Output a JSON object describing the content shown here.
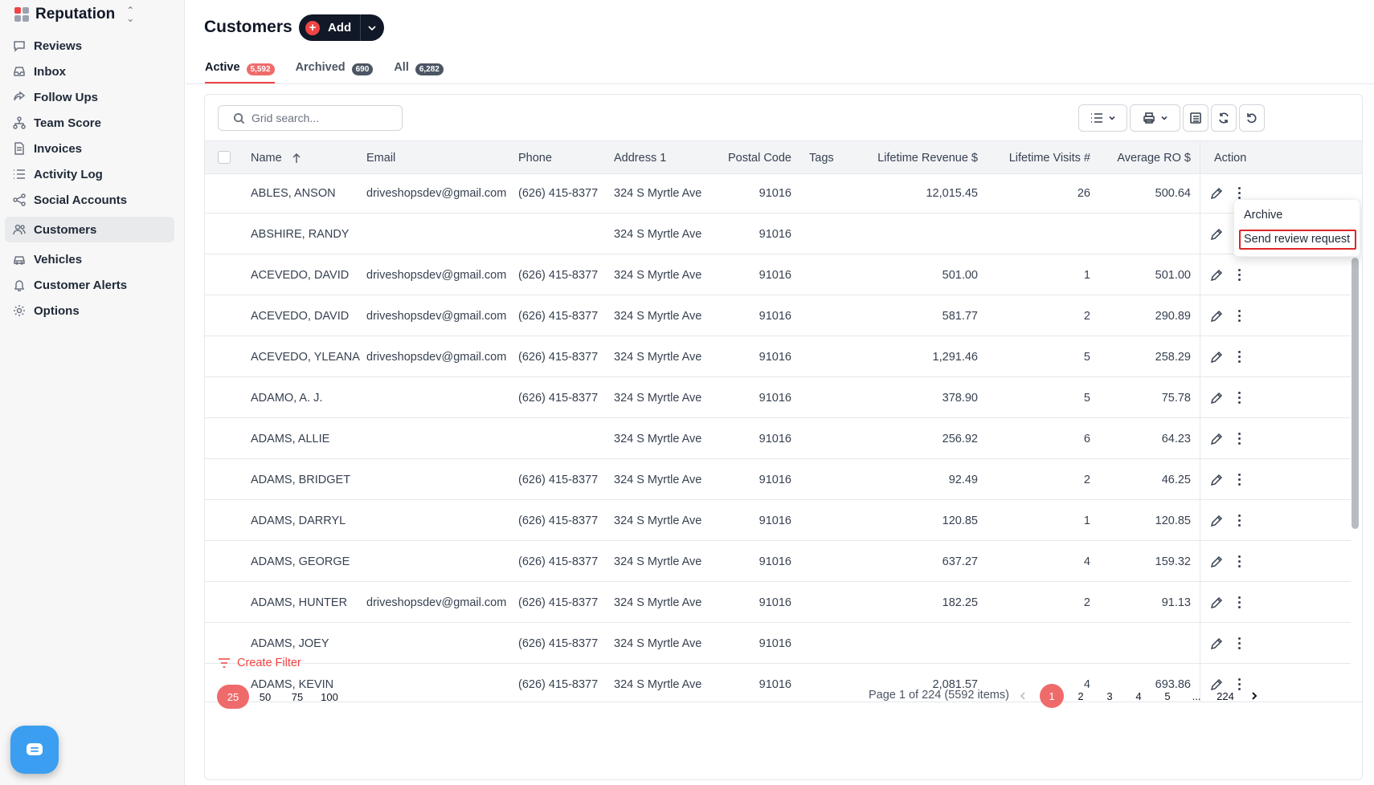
{
  "brand": {
    "name": "Reputation"
  },
  "sidebar": {
    "items": [
      {
        "label": "Reviews",
        "icon": "message-square-icon"
      },
      {
        "label": "Inbox",
        "icon": "inbox-icon"
      },
      {
        "label": "Follow Ups",
        "icon": "share-icon"
      },
      {
        "label": "Team Score",
        "icon": "org-chart-icon"
      },
      {
        "label": "Invoices",
        "icon": "file-text-icon"
      },
      {
        "label": "Activity Log",
        "icon": "list-icon"
      },
      {
        "label": "Social Accounts",
        "icon": "share-nodes-icon"
      },
      {
        "label": "Customers",
        "icon": "users-icon",
        "active": true
      },
      {
        "label": "Vehicles",
        "icon": "car-icon"
      },
      {
        "label": "Customer Alerts",
        "icon": "bell-icon"
      },
      {
        "label": "Options",
        "icon": "gear-icon"
      }
    ]
  },
  "header": {
    "title": "Customers",
    "add_label": "Add"
  },
  "tabs": [
    {
      "label": "Active",
      "count": "5,592",
      "active": true
    },
    {
      "label": "Archived",
      "count": "690"
    },
    {
      "label": "All",
      "count": "6,282"
    }
  ],
  "search": {
    "placeholder": "Grid search..."
  },
  "columns": {
    "name": "Name",
    "email": "Email",
    "phone": "Phone",
    "address": "Address 1",
    "postal": "Postal Code",
    "tags": "Tags",
    "revenue": "Lifetime Revenue $",
    "visits": "Lifetime Visits #",
    "avg": "Average RO $",
    "action": "Action"
  },
  "rows": [
    {
      "name": "ABLES, ANSON",
      "email": "driveshopsdev@gmail.com",
      "phone": "(626) 415-8377",
      "address": "324 S Myrtle Ave",
      "postal": "91016",
      "revenue": "12,015.45",
      "visits": "26",
      "avg": "500.64"
    },
    {
      "name": "ABSHIRE, RANDY",
      "email": "",
      "phone": "",
      "address": "324 S Myrtle Ave",
      "postal": "91016",
      "revenue": "",
      "visits": "",
      "avg": ""
    },
    {
      "name": "ACEVEDO, DAVID",
      "email": "driveshopsdev@gmail.com",
      "phone": "(626) 415-8377",
      "address": "324 S Myrtle Ave",
      "postal": "91016",
      "revenue": "501.00",
      "visits": "1",
      "avg": "501.00"
    },
    {
      "name": "ACEVEDO, DAVID",
      "email": "driveshopsdev@gmail.com",
      "phone": "(626) 415-8377",
      "address": "324 S Myrtle Ave",
      "postal": "91016",
      "revenue": "581.77",
      "visits": "2",
      "avg": "290.89"
    },
    {
      "name": "ACEVEDO, YLEANA",
      "email": "driveshopsdev@gmail.com",
      "phone": "(626) 415-8377",
      "address": "324 S Myrtle Ave",
      "postal": "91016",
      "revenue": "1,291.46",
      "visits": "5",
      "avg": "258.29"
    },
    {
      "name": "ADAMO, A. J.",
      "email": "",
      "phone": "(626) 415-8377",
      "address": "324 S Myrtle Ave",
      "postal": "91016",
      "revenue": "378.90",
      "visits": "5",
      "avg": "75.78"
    },
    {
      "name": "ADAMS, ALLIE",
      "email": "",
      "phone": "",
      "address": "324 S Myrtle Ave",
      "postal": "91016",
      "revenue": "256.92",
      "visits": "6",
      "avg": "64.23"
    },
    {
      "name": "ADAMS, BRIDGET",
      "email": "",
      "phone": "(626) 415-8377",
      "address": "324 S Myrtle Ave",
      "postal": "91016",
      "revenue": "92.49",
      "visits": "2",
      "avg": "46.25"
    },
    {
      "name": "ADAMS, DARRYL",
      "email": "",
      "phone": "(626) 415-8377",
      "address": "324 S Myrtle Ave",
      "postal": "91016",
      "revenue": "120.85",
      "visits": "1",
      "avg": "120.85"
    },
    {
      "name": "ADAMS, GEORGE",
      "email": "",
      "phone": "(626) 415-8377",
      "address": "324 S Myrtle Ave",
      "postal": "91016",
      "revenue": "637.27",
      "visits": "4",
      "avg": "159.32"
    },
    {
      "name": "ADAMS, HUNTER",
      "email": "driveshopsdev@gmail.com",
      "phone": "(626) 415-8377",
      "address": "324 S Myrtle Ave",
      "postal": "91016",
      "revenue": "182.25",
      "visits": "2",
      "avg": "91.13"
    },
    {
      "name": "ADAMS, JOEY",
      "email": "",
      "phone": "(626) 415-8377",
      "address": "324 S Myrtle Ave",
      "postal": "91016",
      "revenue": "",
      "visits": "",
      "avg": ""
    },
    {
      "name": "ADAMS, KEVIN",
      "email": "",
      "phone": "(626) 415-8377",
      "address": "324 S Myrtle Ave",
      "postal": "91016",
      "revenue": "2,081.57",
      "visits": "4",
      "avg": "693.86"
    }
  ],
  "row_menu": {
    "archive": "Archive",
    "send_review": "Send review request"
  },
  "footer": {
    "create_filter": "Create Filter",
    "page_sizes": [
      "25",
      "50",
      "75",
      "100"
    ],
    "page_info": "Page 1 of 224 (5592 items)",
    "pages": [
      "1",
      "2",
      "3",
      "4",
      "5",
      "...",
      "224"
    ]
  },
  "colors": {
    "accent": "#ef4444",
    "badge_active": "#ef6b6b",
    "highlight_box": "#dc2626"
  }
}
